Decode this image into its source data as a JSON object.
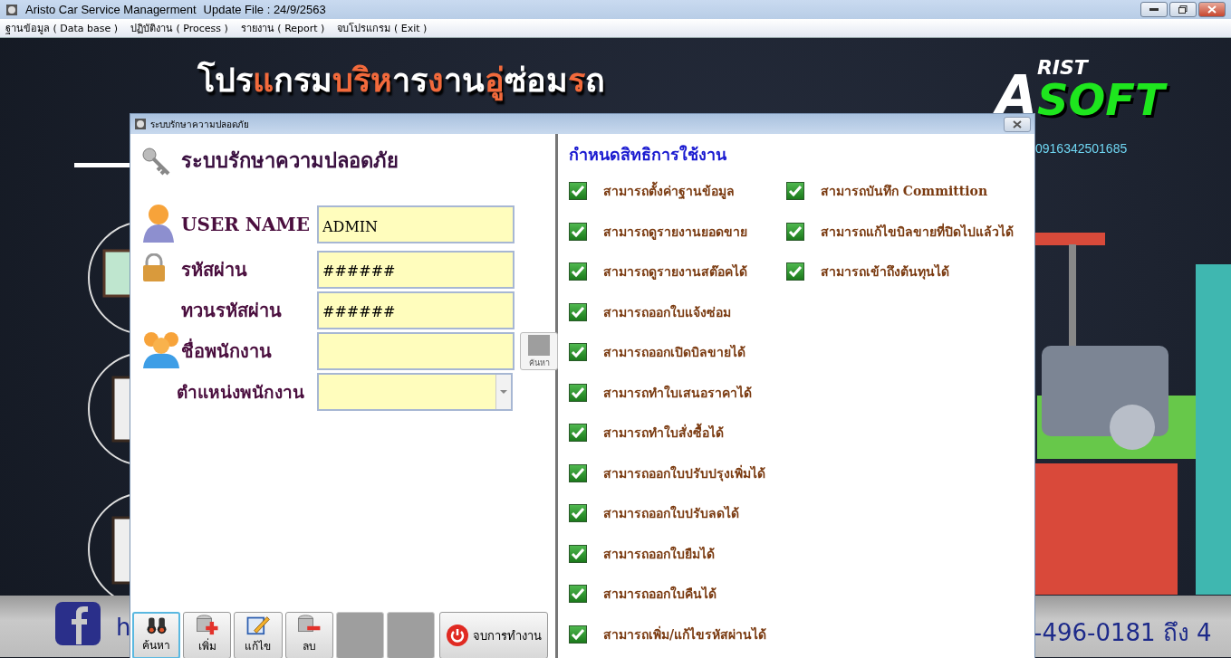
{
  "window": {
    "title": "Aristo Car Service Managerment",
    "update": "Update File : 24/9/2563"
  },
  "menu": [
    "ฐานข้อมูล ( Data base )",
    "ปฏิบัติงาน ( Process )",
    "รายงาน ( Report )",
    "จบโปรแกรม ( Exit )"
  ],
  "banner": {
    "segments": [
      {
        "text": "โปร",
        "color": "#ffffff"
      },
      {
        "text": "แ",
        "color": "#f26a3c"
      },
      {
        "text": "กรม",
        "color": "#ffffff"
      },
      {
        "text": "บริห",
        "color": "#f26a3c"
      },
      {
        "text": "าร",
        "color": "#ffffff"
      },
      {
        "text": "ง",
        "color": "#f26a3c"
      },
      {
        "text": "าน",
        "color": "#ffffff"
      },
      {
        "text": "อู่",
        "color": "#f26a3c"
      },
      {
        "text": "ซ่อม",
        "color": "#ffffff"
      },
      {
        "text": "ร",
        "color": "#f26a3c"
      },
      {
        "text": "ถ",
        "color": "#ffffff"
      }
    ],
    "logo_first": "A",
    "logo_second": "RIST",
    "logo_third": "SOFT",
    "phone": "0916342501685",
    "footer_left": "h",
    "footer_right": "-496-0181 ถึง 4"
  },
  "dialog": {
    "title": "ระบบรักษาความปลอดภัย",
    "heading": "ระบบรักษาความปลอดภัย",
    "fields": [
      {
        "kind": "text",
        "label": "USER NAME",
        "value": "ADMIN"
      },
      {
        "kind": "text",
        "label": "รหัสผ่าน",
        "value": "######"
      },
      {
        "kind": "text",
        "label": "ทวนรหัสผ่าน",
        "value": "######"
      },
      {
        "kind": "search",
        "label": "ชื่อพนักงาน",
        "button": "ค้นหา"
      },
      {
        "kind": "combo",
        "label": "ตำแหน่งพนักงาน"
      }
    ],
    "permissions_title": "กำหนดสิทธิการใช้งาน",
    "permissions": [
      {
        "label": "สามารถตั้งค่าฐานข้อมูล",
        "checked": true
      },
      {
        "label": "สามารถดูรายงานยอดขาย",
        "checked": true
      },
      {
        "label": "สามารถดูรายงานสต๊อคได้",
        "checked": true
      },
      {
        "label": "สามารถออกใบแจ้งซ่อม",
        "checked": true
      },
      {
        "label": "สามารถออกเปิดบิลขายได้",
        "checked": true
      },
      {
        "label": "สามารถทำใบเสนอราคาได้",
        "checked": true
      },
      {
        "label": "สามารถทำใบสั่งซื้อได้",
        "checked": true
      },
      {
        "label": "สามารถออกใบปรับปรุงเพิ่มได้",
        "checked": true
      },
      {
        "label": "สามารถออกใบปรับลดได้",
        "checked": true
      },
      {
        "label": "สามารถออกใบยืมได้",
        "checked": true
      },
      {
        "label": "สามารถออกใบคืนได้",
        "checked": true
      },
      {
        "label": "สามารถเพิ่ม/แก้ไขรหัสผ่านได้",
        "checked": true
      }
    ],
    "permissions_2": [
      {
        "label": "สามารถบันทึก Committion",
        "checked": true
      },
      {
        "label": "สามารถแก้ไขบิลขายที่ปิดไปแล้วได้",
        "checked": true
      },
      {
        "label": "สามารถเข้าถึงต้นทุนได้",
        "checked": true
      }
    ],
    "buttons": [
      {
        "kind": "icon",
        "label": "ค้นหา",
        "focused": true
      },
      {
        "kind": "icon",
        "label": "เพิ่ม",
        "focused": false
      },
      {
        "kind": "icon",
        "label": "แก้ไข",
        "focused": false
      },
      {
        "kind": "icon",
        "label": "ลบ",
        "focused": false
      },
      {
        "kind": "blank"
      },
      {
        "kind": "blank"
      },
      {
        "kind": "wide",
        "label": "จบการทำงาน",
        "focused": false
      }
    ]
  }
}
